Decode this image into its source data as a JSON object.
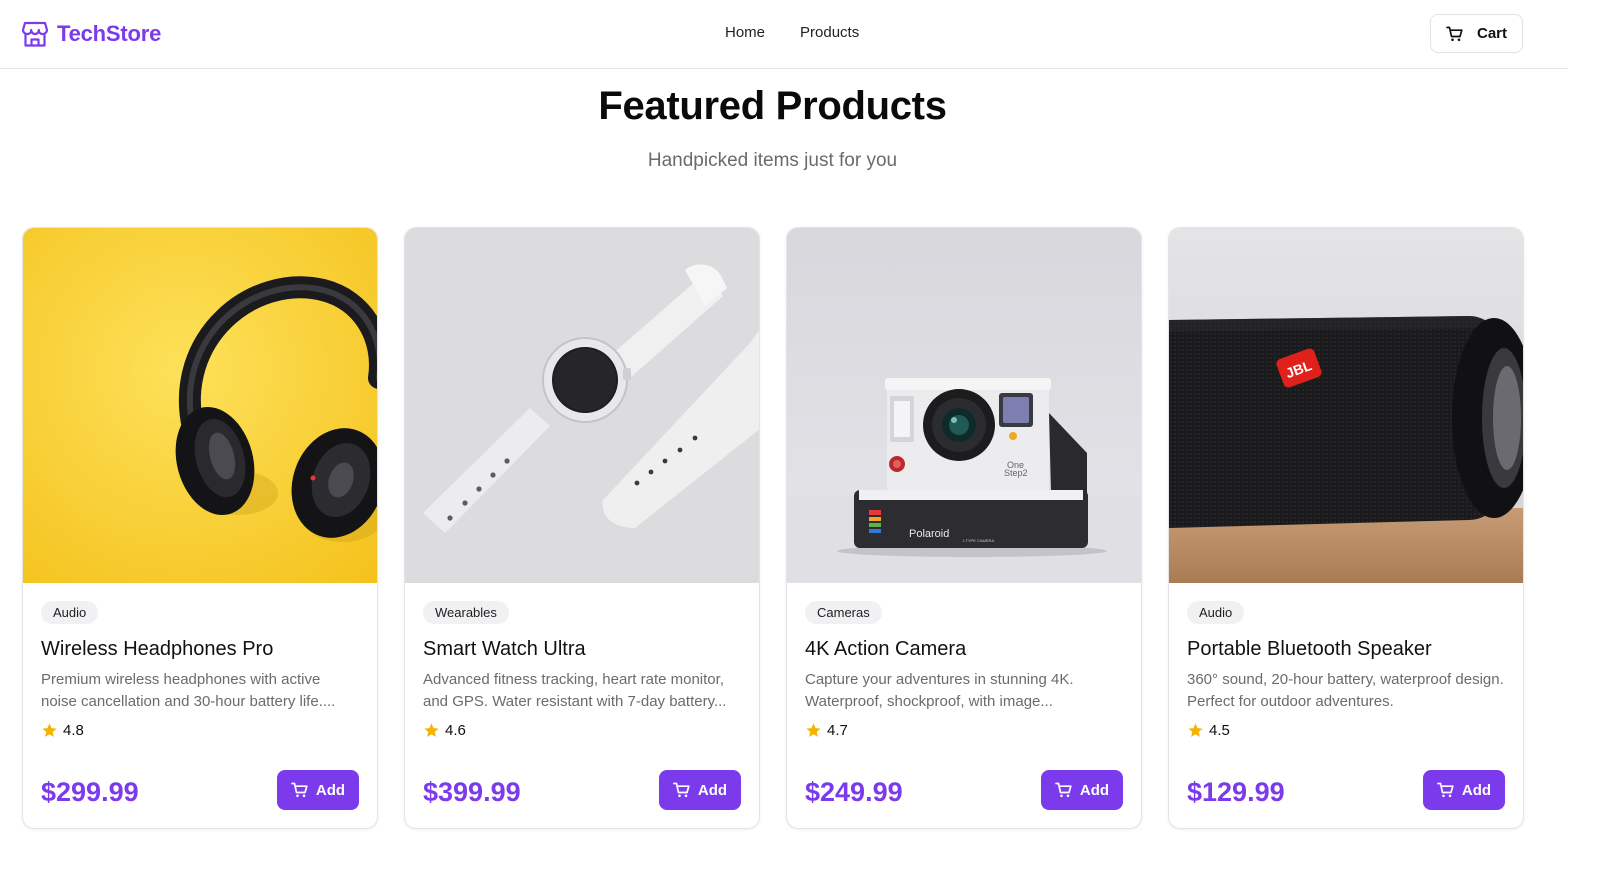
{
  "header": {
    "brand": "TechStore",
    "nav": [
      "Home",
      "Products"
    ],
    "cart_label": "Cart"
  },
  "hero": {
    "title": "Featured Products",
    "subtitle": "Handpicked items just for you"
  },
  "products": [
    {
      "category": "Audio",
      "name": "Wireless Headphones Pro",
      "description": "Premium wireless headphones with active noise cancellation and 30-hour battery life....",
      "rating": "4.8",
      "price": "$299.99",
      "button": "Add",
      "image": "headphones-on-yellow"
    },
    {
      "category": "Wearables",
      "name": "Smart Watch Ultra",
      "description": "Advanced fitness tracking, heart rate monitor, and GPS. Water resistant with 7-day battery...",
      "rating": "4.6",
      "price": "$399.99",
      "button": "Add",
      "image": "white-smartwatch"
    },
    {
      "category": "Cameras",
      "name": "4K Action Camera",
      "description": "Capture your adventures in stunning 4K. Waterproof, shockproof, with image...",
      "rating": "4.7",
      "price": "$249.99",
      "button": "Add",
      "image": "instant-camera",
      "image_text": [
        "Polaroid",
        "One",
        "Step2",
        "I-TYPE CAMERA"
      ]
    },
    {
      "category": "Audio",
      "name": "Portable Bluetooth Speaker",
      "description": "360° sound, 20-hour battery, waterproof design. Perfect for outdoor adventures.",
      "rating": "4.5",
      "price": "$129.99",
      "button": "Add",
      "image": "black-speaker",
      "image_text": [
        "JBL"
      ]
    }
  ],
  "colors": {
    "accent": "#7c3aed",
    "star": "#f5b301",
    "muted_text": "#6b6b6b",
    "border": "#e4e4e7"
  },
  "icons": {
    "brand": "store-icon",
    "cart": "cart-icon",
    "star": "star-icon"
  }
}
